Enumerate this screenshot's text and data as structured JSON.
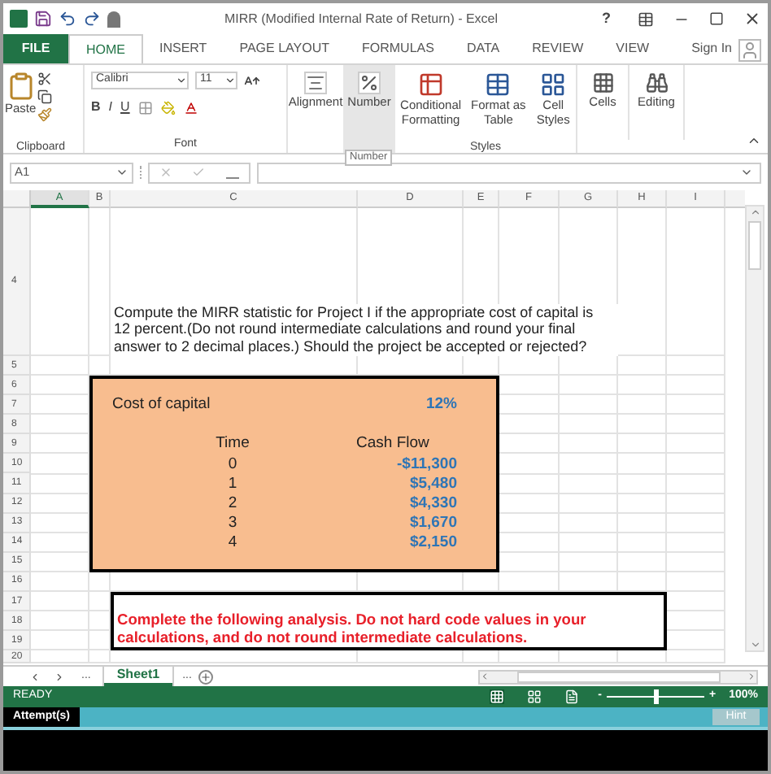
{
  "window": {
    "title": "MIRR (Modified Internal Rate of Return) - Excel",
    "help": "?",
    "sign_in": "Sign In"
  },
  "ribbon_tabs": [
    {
      "label": "FILE",
      "kind": "file",
      "selected": false
    },
    {
      "label": "HOME",
      "kind": "tab",
      "selected": true
    },
    {
      "label": "INSERT",
      "kind": "tab",
      "selected": false
    },
    {
      "label": "PAGE LAYOUT",
      "kind": "tab",
      "selected": false
    },
    {
      "label": "FORMULAS",
      "kind": "tab",
      "selected": false
    },
    {
      "label": "DATA",
      "kind": "tab",
      "selected": false
    },
    {
      "label": "REVIEW",
      "kind": "tab",
      "selected": false
    },
    {
      "label": "VIEW",
      "kind": "tab",
      "selected": false
    }
  ],
  "ribbon": {
    "paste": "Paste",
    "clipboard_label": "Clipboard",
    "font_name": "Calibri",
    "font_size": "11",
    "bold": "B",
    "italic": "I",
    "underline": "U",
    "font_label": "Font",
    "alignment": "Alignment",
    "number": "Number",
    "conditional_formatting": "Conditional Formatting",
    "format_as_table": "Format as Table",
    "cell_styles": "Cell Styles",
    "styles_label": "Styles",
    "cells": "Cells",
    "editing": "Editing",
    "tooltip": "Number"
  },
  "formula_bar": {
    "name_box": "A1"
  },
  "columns": [
    {
      "label": "A",
      "selected": true
    },
    {
      "label": "B",
      "selected": false
    },
    {
      "label": "C",
      "selected": false
    },
    {
      "label": "D",
      "selected": false
    },
    {
      "label": "E",
      "selected": false
    },
    {
      "label": "F",
      "selected": false
    },
    {
      "label": "G",
      "selected": false
    },
    {
      "label": "H",
      "selected": false
    },
    {
      "label": "I",
      "selected": false
    }
  ],
  "rows": [
    "4",
    "5",
    "6",
    "7",
    "8",
    "9",
    "10",
    "11",
    "12",
    "13",
    "14",
    "15",
    "16",
    "17",
    "18",
    "19",
    "20"
  ],
  "question": "Compute the MIRR statistic for Project I if the appropriate cost of capital is 12 percent.(Do not round intermediate calculations and round your final answer to 2 decimal places.) Should the project be accepted or rejected?",
  "inputs": {
    "cost_label": "Cost of capital",
    "cost_value": "12%",
    "time_header": "Time",
    "cash_header": "Cash Flow",
    "cash_flows": [
      {
        "time": "0",
        "amount": "-$11,300"
      },
      {
        "time": "1",
        "amount": "$5,480"
      },
      {
        "time": "2",
        "amount": "$4,330"
      },
      {
        "time": "3",
        "amount": "$1,670"
      },
      {
        "time": "4",
        "amount": "$2,150"
      }
    ]
  },
  "instruction": "Complete the following analysis. Do not hard code values in your calculations, and do not round intermediate calculations.",
  "sheet_tabs": [
    {
      "label": "Sheet1",
      "selected": true
    }
  ],
  "sheet_more": "...",
  "status_bar": {
    "status": "READY",
    "zoom_minus": "-",
    "zoom_plus": "+",
    "zoom": "100%",
    "level": 0.5
  },
  "attempt_bar": {
    "label": "Attempt(s)",
    "hint": "Hint",
    "hint_disabled": true
  }
}
